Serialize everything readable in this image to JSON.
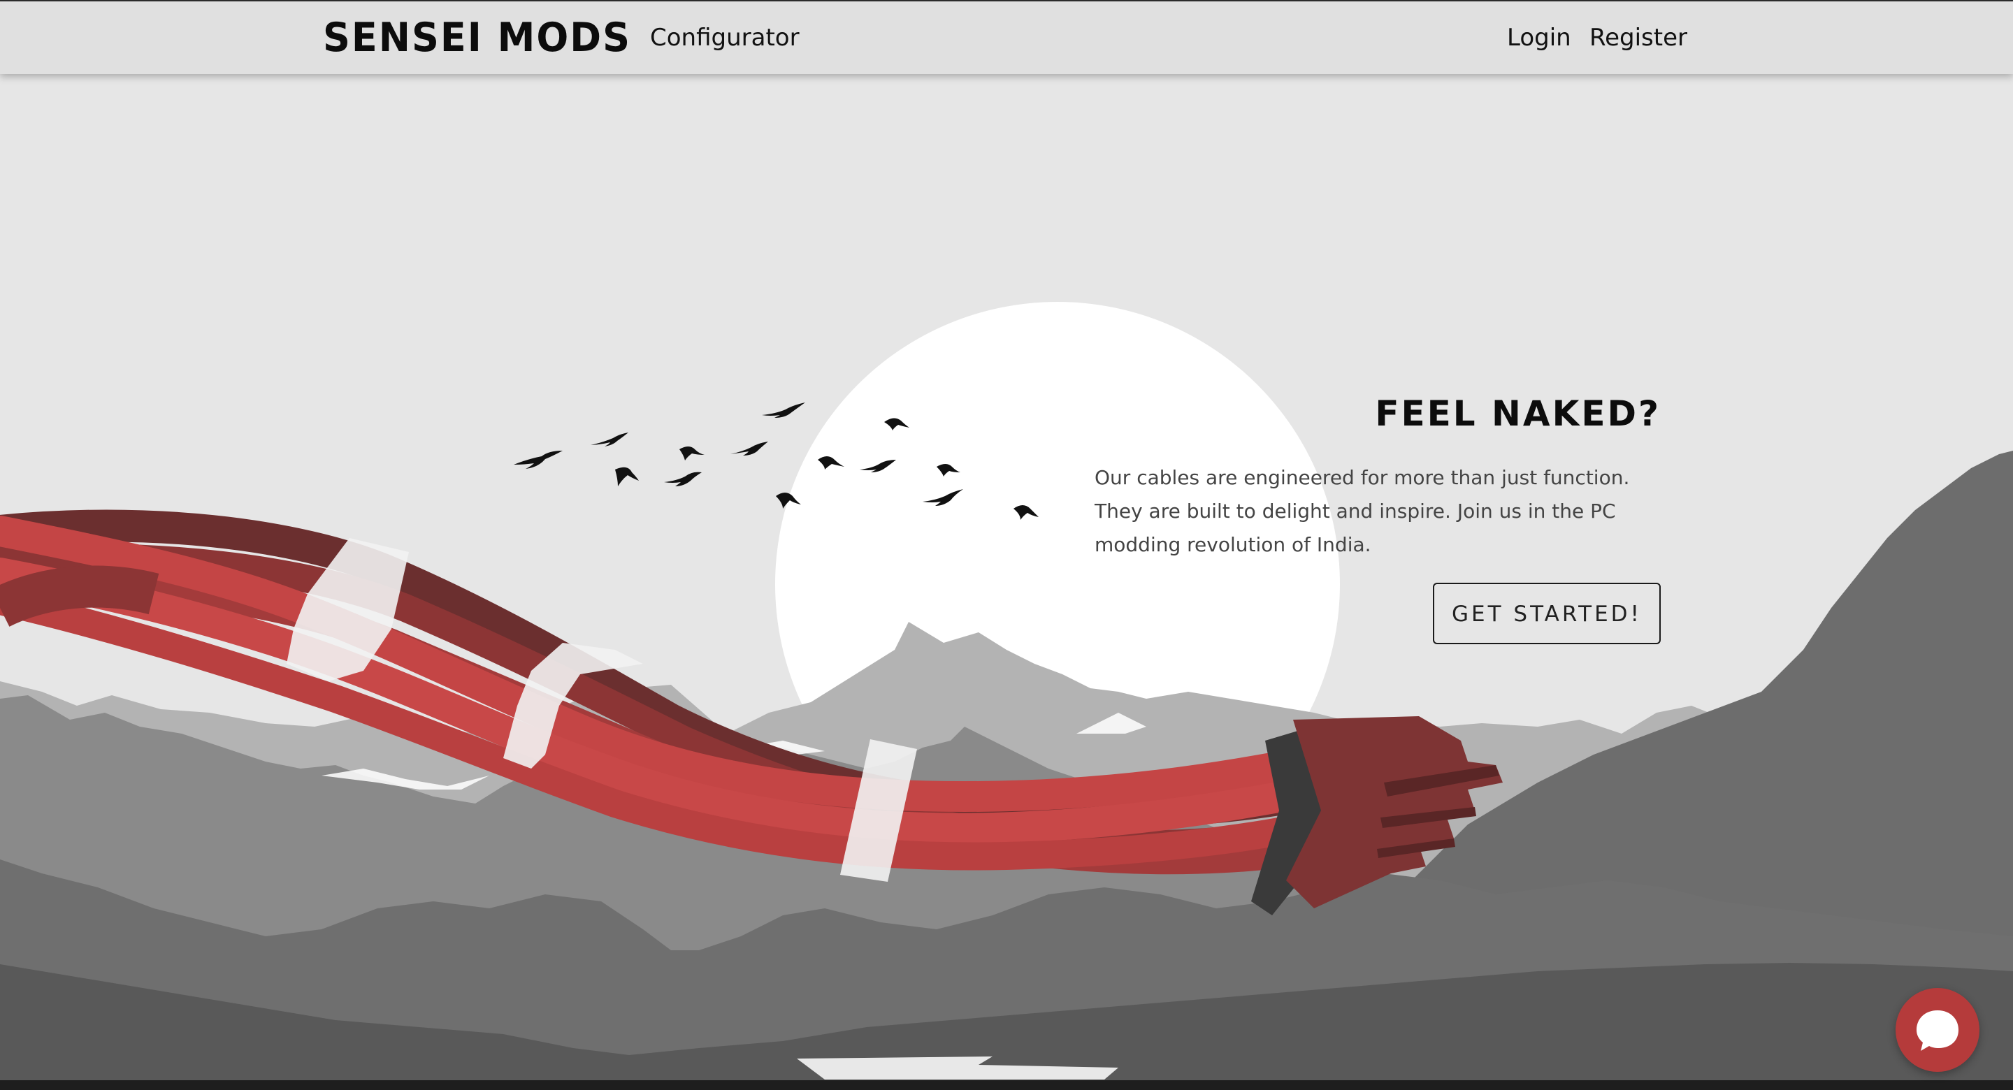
{
  "navbar": {
    "brand": "SENSEI MODS",
    "configurator": "Configurator",
    "login": "Login",
    "register": "Register"
  },
  "hero": {
    "title": "FEEL NAKED?",
    "description": "Our cables are engineered for more than just function. They are built to delight and inspire. Join us in the PC modding revolution of India.",
    "cta": "GET STARTED!"
  },
  "chat": {
    "icon": "chat-bubble-icon"
  },
  "colors": {
    "navbar_bg": "#e0e0e0",
    "page_bg": "#e6e6e6",
    "cable_red": "#c54444",
    "cable_dark": "#7e3434",
    "chat_accent": "#b53b3b",
    "sun": "#ffffff"
  }
}
